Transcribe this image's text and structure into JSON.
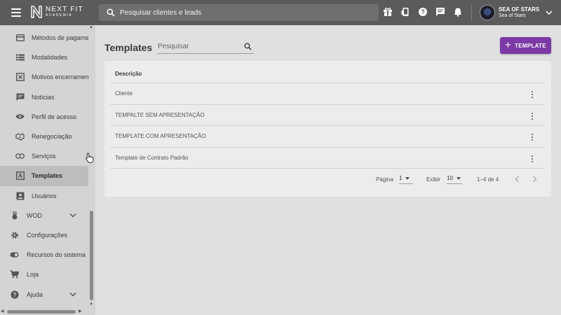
{
  "topbar": {
    "logo_line1": "NEXT FIT",
    "logo_line2": "ACADEMIA",
    "search_placeholder": "Pesquisar clientes e leads",
    "icons": [
      "gift-icon",
      "mobile-icon",
      "help-icon",
      "chat-icon",
      "bell-icon"
    ],
    "account_name": "SEA OF STARS",
    "account_sub": "Sea of Stars"
  },
  "sidebar": {
    "items": [
      {
        "label": "Métodos de pagamento",
        "icon": "credit-card-icon"
      },
      {
        "label": "Modalidades",
        "icon": "list-icon"
      },
      {
        "label": "Motivos encerramento",
        "icon": "close-box-icon"
      },
      {
        "label": "Notícias",
        "icon": "message-icon"
      },
      {
        "label": "Perfil de acesso",
        "icon": "eye-icon"
      },
      {
        "label": "Renegociação",
        "icon": "handshake-icon"
      },
      {
        "label": "Serviços",
        "icon": "services-icon"
      },
      {
        "label": "Templates",
        "icon": "template-icon",
        "active": true
      },
      {
        "label": "Usuários",
        "icon": "user-card-icon"
      }
    ],
    "groups": [
      {
        "label": "WOD",
        "icon": "kettlebell-icon",
        "expandable": true
      },
      {
        "label": "Configurações",
        "icon": "gear-icon"
      },
      {
        "label": "Recursos do sistema",
        "icon": "toggle-icon"
      },
      {
        "label": "Loja",
        "icon": "cart-icon"
      },
      {
        "label": "Ajuda",
        "icon": "help-icon",
        "expandable": true
      }
    ]
  },
  "main": {
    "title": "Templates",
    "search_placeholder": "Pesquisar",
    "add_button": "TEMPLATE",
    "table": {
      "header": "Descrição",
      "rows": [
        "Cliente",
        "TEMPALTE SEM APRESENTAÇÃO",
        "TEMPLATE COM APRESENTAÇÃO",
        "Template de Contrato Padrão"
      ]
    },
    "pagination": {
      "page_label": "Página",
      "page_value": "1",
      "show_label": "Exibir",
      "show_value": "10",
      "range": "1–4 de 4"
    }
  },
  "colors": {
    "topbar": "#5b5b5b",
    "sidebar": "#d4d4d4",
    "accent": "#7b3aa5",
    "background": "#e0e0e0",
    "card": "#ececec"
  }
}
